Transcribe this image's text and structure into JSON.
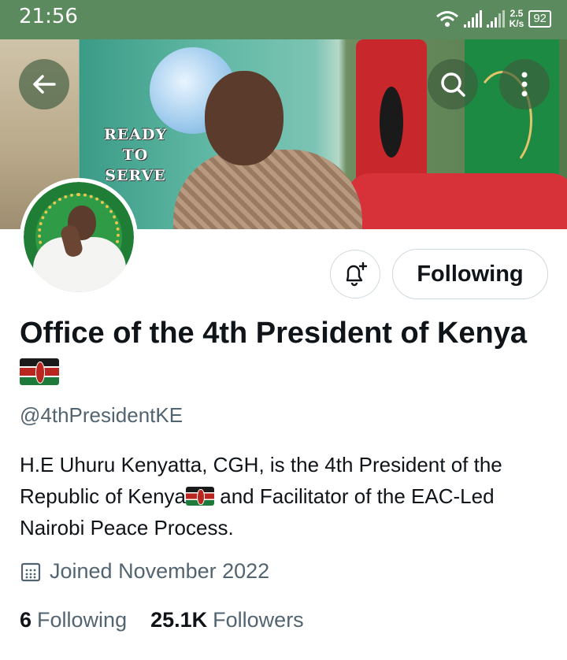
{
  "status_bar": {
    "time": "21:56",
    "net_speed_value": "2.5",
    "net_speed_unit": "K/s",
    "battery": "92"
  },
  "banner": {
    "overlay_text_line1": "READY",
    "overlay_text_line2": "TO",
    "overlay_text_line3": "SERVE"
  },
  "nav": {
    "back_icon": "arrow-left-icon",
    "search_icon": "search-icon",
    "more_icon": "more-vertical-icon"
  },
  "actions": {
    "notify_icon": "bell-plus-icon",
    "follow_label": "Following"
  },
  "profile": {
    "name_text": "Office of the 4th President of Kenya",
    "handle": "@4thPresidentKE",
    "bio_part1": "H.E Uhuru Kenyatta, CGH, is the 4th President of the Republic of Kenya",
    "bio_part2": " and Facilitator of the EAC-Led Nairobi Peace Process.",
    "joined": "Joined November 2022",
    "following_count": "6",
    "following_label": "Following",
    "followers_count": "25.1K",
    "followers_label": "Followers"
  },
  "colors": {
    "status_bar_bg": "#5a8a5e",
    "secondary_text": "#536471",
    "primary_text": "#0f1419",
    "border": "#cfd9de"
  }
}
